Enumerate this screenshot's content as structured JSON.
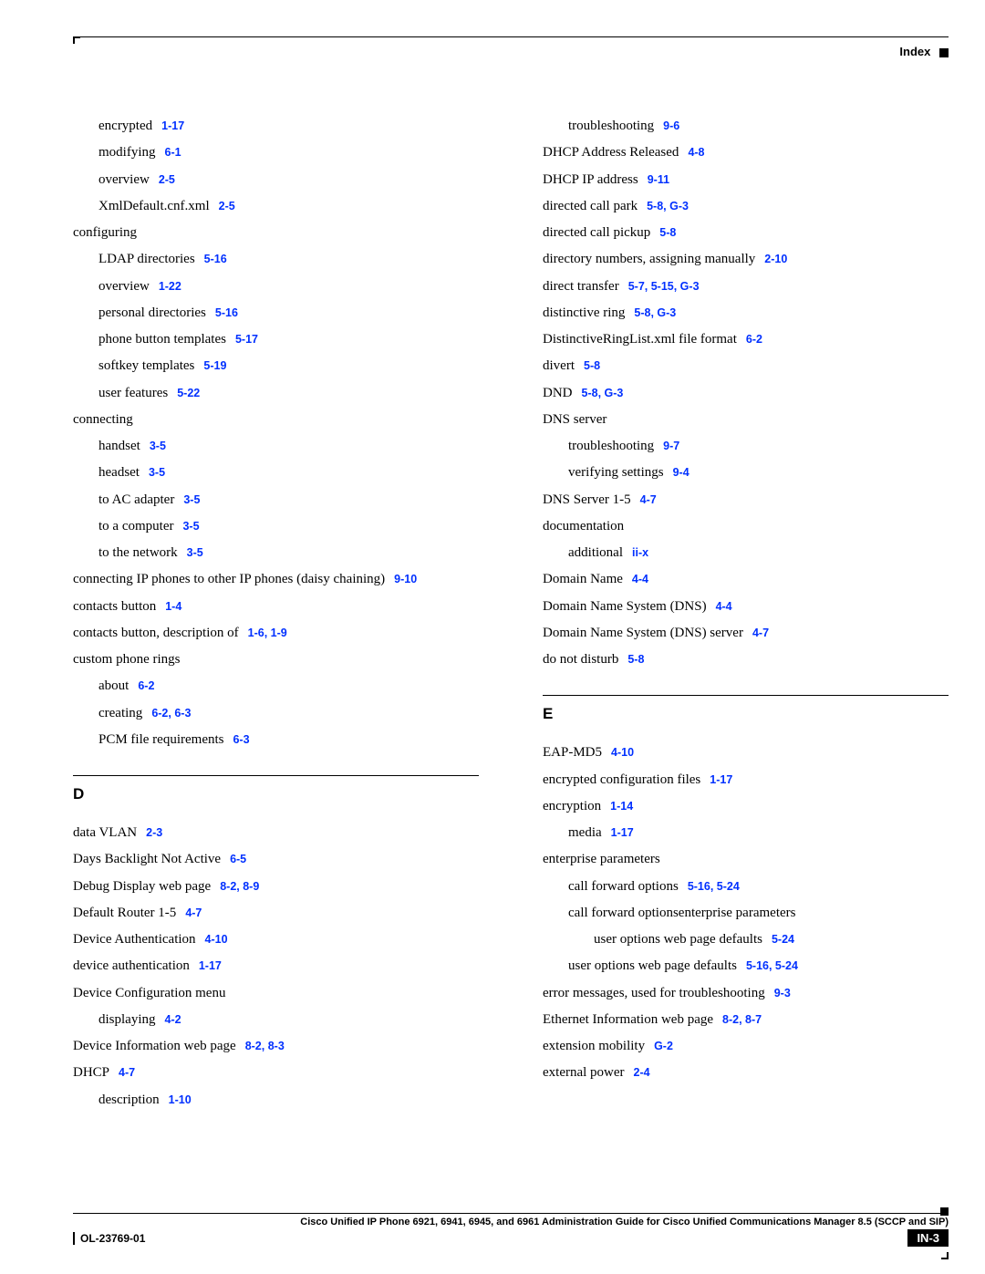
{
  "header": {
    "label": "Index"
  },
  "footer": {
    "title": "Cisco Unified IP Phone 6921, 6941, 6945, and 6961 Administration Guide for Cisco Unified Communications Manager 8.5 (SCCP and SIP)",
    "docnum": "OL-23769-01",
    "page": "IN-3"
  },
  "left": [
    {
      "t": "encrypted",
      "r": "1-17",
      "i": 1
    },
    {
      "t": "modifying",
      "r": "6-1",
      "i": 1
    },
    {
      "t": "overview",
      "r": "2-5",
      "i": 1
    },
    {
      "t": "XmlDefault.cnf.xml",
      "r": "2-5",
      "i": 1
    },
    {
      "t": "configuring",
      "r": "",
      "i": 0
    },
    {
      "t": "LDAP directories",
      "r": "5-16",
      "i": 1
    },
    {
      "t": "overview",
      "r": "1-22",
      "i": 1
    },
    {
      "t": "personal directories",
      "r": "5-16",
      "i": 1
    },
    {
      "t": "phone button templates",
      "r": "5-17",
      "i": 1
    },
    {
      "t": "softkey templates",
      "r": "5-19",
      "i": 1
    },
    {
      "t": "user features",
      "r": "5-22",
      "i": 1
    },
    {
      "t": "connecting",
      "r": "",
      "i": 0
    },
    {
      "t": "handset",
      "r": "3-5",
      "i": 1
    },
    {
      "t": "headset",
      "r": "3-5",
      "i": 1
    },
    {
      "t": "to AC adapter",
      "r": "3-5",
      "i": 1
    },
    {
      "t": "to a computer",
      "r": "3-5",
      "i": 1
    },
    {
      "t": "to the network",
      "r": "3-5",
      "i": 1
    },
    {
      "t": "connecting IP phones to other IP phones (daisy chaining)",
      "r": "9-10",
      "i": 0
    },
    {
      "t": "contacts button",
      "r": "1-4",
      "i": 0
    },
    {
      "t": "contacts button, description of",
      "r": "1-6, 1-9",
      "i": 0
    },
    {
      "t": "custom phone rings",
      "r": "",
      "i": 0
    },
    {
      "t": "about",
      "r": "6-2",
      "i": 1
    },
    {
      "t": "creating",
      "r": "6-2, 6-3",
      "i": 1
    },
    {
      "t": "PCM file requirements",
      "r": "6-3",
      "i": 1
    }
  ],
  "left_letter": "D",
  "left_d": [
    {
      "t": "data VLAN",
      "r": "2-3",
      "i": 0
    },
    {
      "t": "Days Backlight Not Active",
      "r": "6-5",
      "i": 0
    },
    {
      "t": "Debug Display web page",
      "r": "8-2, 8-9",
      "i": 0
    },
    {
      "t": "Default Router 1-5",
      "r": "4-7",
      "i": 0
    },
    {
      "t": "Device Authentication",
      "r": "4-10",
      "i": 0
    },
    {
      "t": "device authentication",
      "r": "1-17",
      "i": 0
    },
    {
      "t": "Device Configuration menu",
      "r": "",
      "i": 0
    },
    {
      "t": "displaying",
      "r": "4-2",
      "i": 1
    },
    {
      "t": "Device Information web page",
      "r": "8-2, 8-3",
      "i": 0
    },
    {
      "t": "DHCP",
      "r": "4-7",
      "i": 0
    },
    {
      "t": "description",
      "r": "1-10",
      "i": 1
    }
  ],
  "right": [
    {
      "t": "troubleshooting",
      "r": "9-6",
      "i": 1
    },
    {
      "t": "DHCP Address Released",
      "r": "4-8",
      "i": 0
    },
    {
      "t": "DHCP IP address",
      "r": "9-11",
      "i": 0
    },
    {
      "t": "directed call park",
      "r": "5-8, G-3",
      "i": 0
    },
    {
      "t": "directed call pickup",
      "r": "5-8",
      "i": 0
    },
    {
      "t": "directory numbers, assigning manually",
      "r": "2-10",
      "i": 0
    },
    {
      "t": "direct transfer",
      "r": "5-7, 5-15, G-3",
      "i": 0
    },
    {
      "t": "distinctive ring",
      "r": "5-8, G-3",
      "i": 0
    },
    {
      "t": "DistinctiveRingList.xml file format",
      "r": "6-2",
      "i": 0
    },
    {
      "t": "divert",
      "r": "5-8",
      "i": 0
    },
    {
      "t": "DND",
      "r": "5-8, G-3",
      "i": 0
    },
    {
      "t": "DNS server",
      "r": "",
      "i": 0
    },
    {
      "t": "troubleshooting",
      "r": "9-7",
      "i": 1
    },
    {
      "t": "verifying settings",
      "r": "9-4",
      "i": 1
    },
    {
      "t": "DNS Server 1-5",
      "r": "4-7",
      "i": 0
    },
    {
      "t": "documentation",
      "r": "",
      "i": 0
    },
    {
      "t": "additional",
      "r": "ii-x",
      "i": 1
    },
    {
      "t": "Domain Name",
      "r": "4-4",
      "i": 0
    },
    {
      "t": "Domain Name System (DNS)",
      "r": "4-4",
      "i": 0
    },
    {
      "t": "Domain Name System (DNS) server",
      "r": "4-7",
      "i": 0
    },
    {
      "t": "do not disturb",
      "r": "5-8",
      "i": 0
    }
  ],
  "right_letter": "E",
  "right_e": [
    {
      "t": "EAP-MD5",
      "r": "4-10",
      "i": 0
    },
    {
      "t": "encrypted configuration files",
      "r": "1-17",
      "i": 0
    },
    {
      "t": "encryption",
      "r": "1-14",
      "i": 0
    },
    {
      "t": "media",
      "r": "1-17",
      "i": 1
    },
    {
      "t": "enterprise parameters",
      "r": "",
      "i": 0
    },
    {
      "t": "call forward options",
      "r": "5-16, 5-24",
      "i": 1
    },
    {
      "t": "call forward optionsenterprise parameters",
      "r": "",
      "i": 1
    },
    {
      "t": "user options web page defaults",
      "r": "5-24",
      "i": 2
    },
    {
      "t": "user options web page defaults",
      "r": "5-16, 5-24",
      "i": 1
    },
    {
      "t": "error messages, used for troubleshooting",
      "r": "9-3",
      "i": 0
    },
    {
      "t": "Ethernet Information web page",
      "r": "8-2, 8-7",
      "i": 0
    },
    {
      "t": "extension mobility",
      "r": "G-2",
      "i": 0
    },
    {
      "t": "external power",
      "r": "2-4",
      "i": 0
    }
  ]
}
